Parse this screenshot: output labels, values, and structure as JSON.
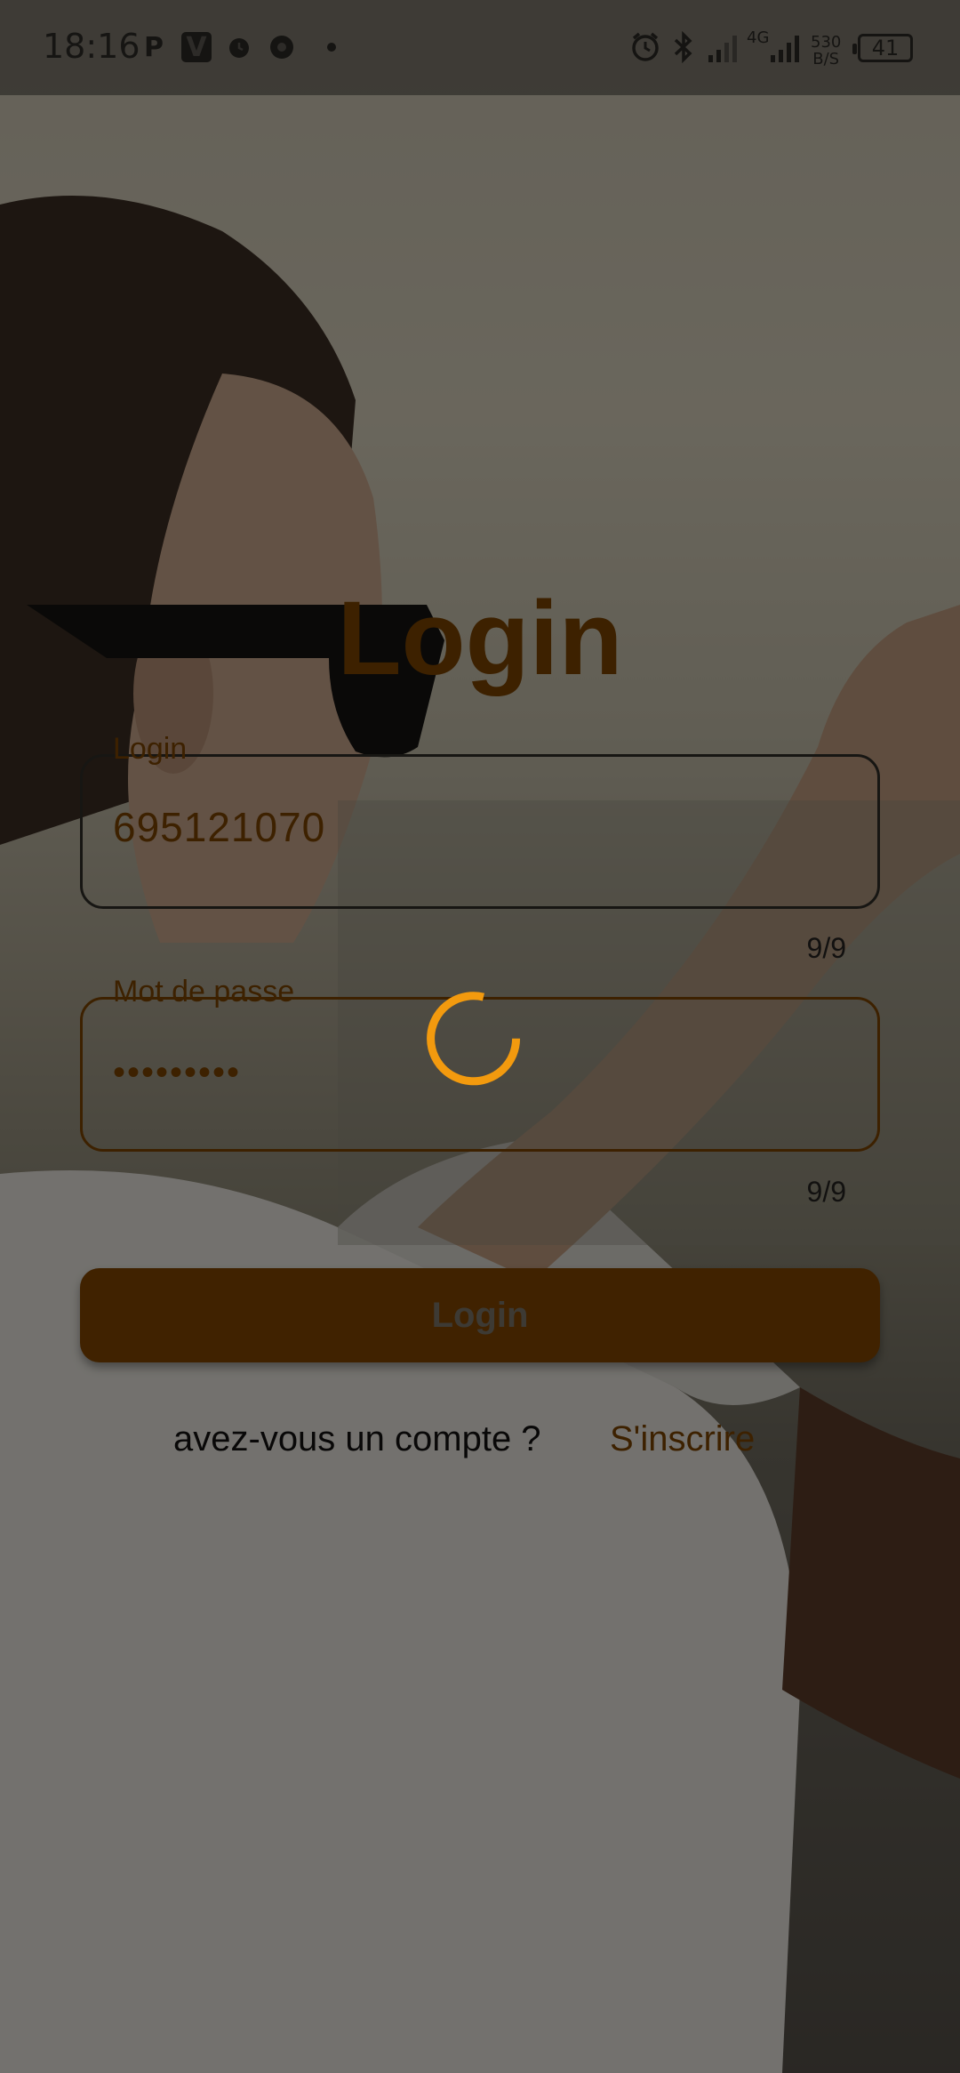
{
  "status_bar": {
    "time": "18:16",
    "net_speed_value": "530",
    "net_speed_unit": "B/S",
    "network_type": "4G",
    "battery": "41"
  },
  "login": {
    "title": "Login",
    "username_label": "Login",
    "username_value": "695121070",
    "username_counter": "9/9",
    "password_label": "Mot de passe",
    "password_value": "•••••••••",
    "password_counter": "9/9",
    "submit_label": "Login",
    "signup_question": "avez-vous un compte ?",
    "signup_link": "S'inscrire"
  },
  "colors": {
    "accent": "#804500",
    "spinner": "#f39a0e"
  },
  "icons": {
    "status_left": [
      "parking-icon",
      "v-app-icon",
      "alarm-icon",
      "chrome-icon",
      "dot-icon"
    ],
    "status_right": [
      "alarm-icon",
      "bluetooth-icon",
      "signal-icon",
      "signal-icon"
    ],
    "loading": "spinner-icon"
  }
}
